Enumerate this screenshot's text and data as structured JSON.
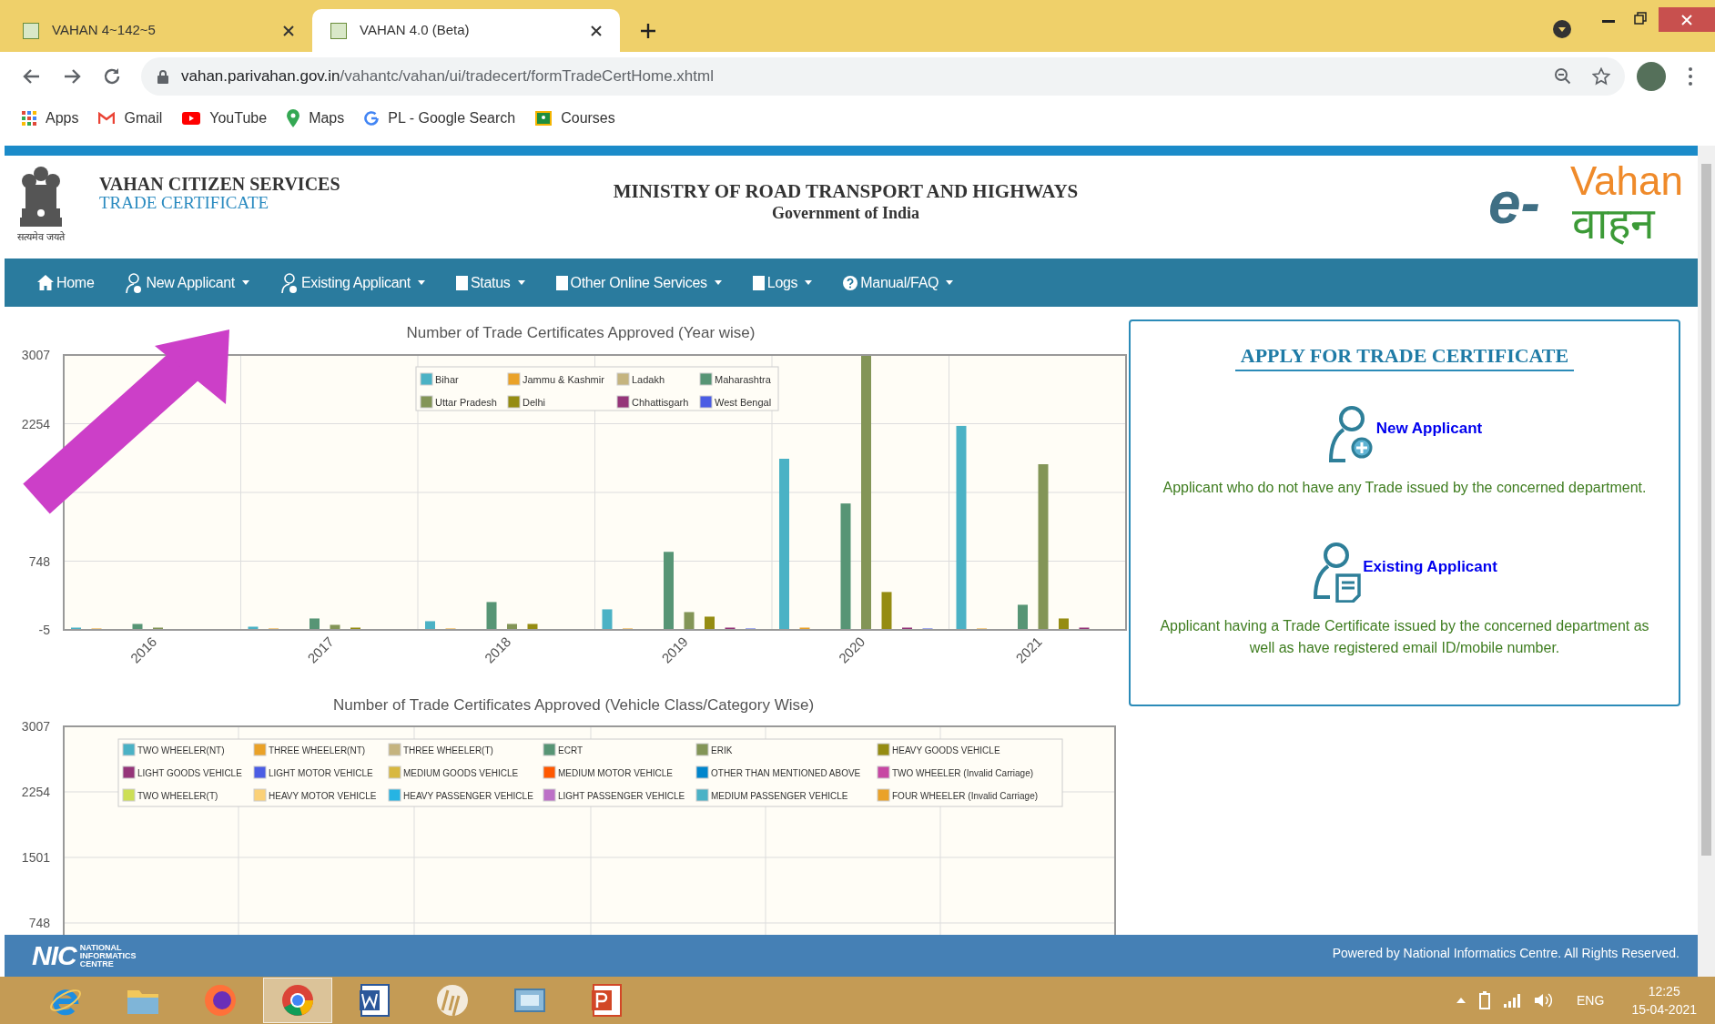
{
  "browser": {
    "tabs": [
      {
        "title": "VAHAN 4~142~5",
        "selected": false
      },
      {
        "title": "VAHAN 4.0 (Beta)",
        "selected": true
      }
    ],
    "address": {
      "domain": "vahan.parivahan.gov.in",
      "path": "/vahantc/vahan/ui/tradecert/formTradeCertHome.xhtml"
    },
    "bookmarks": [
      {
        "kind": "apps",
        "label": "Apps"
      },
      {
        "kind": "gmail",
        "label": "Gmail"
      },
      {
        "kind": "youtube",
        "label": "YouTube"
      },
      {
        "kind": "maps",
        "label": "Maps"
      },
      {
        "kind": "google",
        "label": "PL - Google Search"
      },
      {
        "kind": "classroom",
        "label": "Courses"
      }
    ]
  },
  "header": {
    "emblem_motto": "सत्यमेव जयते",
    "portal": "VAHAN CITIZEN SERVICES",
    "section": "TRADE CERTIFICATE",
    "ministry": "MINISTRY OF ROAD TRANSPORT AND HIGHWAYS",
    "government": "Government of India",
    "logo": {
      "prefix": "e-",
      "latin": "Vahan",
      "devanagari": "वाहन"
    }
  },
  "nav": [
    {
      "kind": "home",
      "label": "Home",
      "dropdown": false
    },
    {
      "kind": "person",
      "label": "New Applicant",
      "dropdown": true
    },
    {
      "kind": "person",
      "label": "Existing Applicant",
      "dropdown": true
    },
    {
      "kind": "page",
      "label": "Status",
      "dropdown": true
    },
    {
      "kind": "page",
      "label": "Other Online Services",
      "dropdown": true
    },
    {
      "kind": "page",
      "label": "Logs",
      "dropdown": true
    },
    {
      "kind": "help",
      "label": "Manual/FAQ",
      "dropdown": true
    }
  ],
  "charts": [
    {
      "chart_data": {
        "type": "bar",
        "title": "Number of Trade Certificates Approved (Year wise)",
        "categories": [
          "2016",
          "2017",
          "2018",
          "2019",
          "2020",
          "2021"
        ],
        "ylim": [
          -5,
          3007
        ],
        "yticks": [
          -5,
          748,
          2254,
          3007
        ],
        "legend": true,
        "grid": true,
        "series": [
          {
            "name": "Bihar",
            "color": "#4bb2c5",
            "values": [
              20,
              30,
              90,
              220,
              1870,
              2230
            ]
          },
          {
            "name": "Jammu & Kashmir",
            "color": "#eaa228",
            "values": [
              10,
              10,
              10,
              10,
              20,
              10
            ]
          },
          {
            "name": "Ladakh",
            "color": "#c5b47f",
            "values": [
              0,
              0,
              0,
              0,
              0,
              0
            ]
          },
          {
            "name": "Maharashtra",
            "color": "#579575",
            "values": [
              60,
              120,
              300,
              850,
              1380,
              270
            ]
          },
          {
            "name": "Uttar Pradesh",
            "color": "#839557",
            "values": [
              20,
              50,
              60,
              190,
              3000,
              1810
            ]
          },
          {
            "name": "Delhi",
            "color": "#958c12",
            "values": [
              0,
              20,
              60,
              140,
              410,
              120
            ]
          },
          {
            "name": "Chhattisgarh",
            "color": "#953579",
            "values": [
              0,
              0,
              0,
              20,
              20,
              20
            ]
          },
          {
            "name": "West Bengal",
            "color": "#4b5de4",
            "values": [
              0,
              0,
              0,
              10,
              10,
              0
            ]
          }
        ]
      }
    },
    {
      "chart_data": {
        "type": "bar",
        "title": "Number of Trade Certificates Approved (Vehicle Class/Category Wise)",
        "ylim": [
          612,
          3007
        ],
        "yticks": [
          748,
          1501,
          2254,
          3007
        ],
        "legend": true,
        "grid": true,
        "series": [
          {
            "name": "TWO WHEELER(NT)",
            "color": "#4bb2c5"
          },
          {
            "name": "THREE WHEELER(NT)",
            "color": "#eaa228"
          },
          {
            "name": "THREE WHEELER(T)",
            "color": "#c5b47f"
          },
          {
            "name": "ECRT",
            "color": "#579575"
          },
          {
            "name": "ERIK",
            "color": "#839557"
          },
          {
            "name": "HEAVY GOODS VEHICLE",
            "color": "#958c12"
          },
          {
            "name": "LIGHT GOODS VEHICLE",
            "color": "#953579"
          },
          {
            "name": "LIGHT MOTOR VEHICLE",
            "color": "#4b5de4"
          },
          {
            "name": "MEDIUM GOODS VEHICLE",
            "color": "#d8b83f"
          },
          {
            "name": "MEDIUM MOTOR VEHICLE",
            "color": "#ff5800"
          },
          {
            "name": "OTHER THAN MENTIONED ABOVE",
            "color": "#0085cc"
          },
          {
            "name": "TWO WHEELER (Invalid Carriage)",
            "color": "#c747a3"
          },
          {
            "name": "TWO WHEELER(T)",
            "color": "#cddf54"
          },
          {
            "name": "HEAVY MOTOR VEHICLE",
            "color": "#fbd178"
          },
          {
            "name": "HEAVY PASSENGER VEHICLE",
            "color": "#26b4e3"
          },
          {
            "name": "LIGHT PASSENGER VEHICLE",
            "color": "#bd70c7"
          },
          {
            "name": "MEDIUM PASSENGER VEHICLE",
            "color": "#4bb2c6"
          },
          {
            "name": "FOUR WHEELER (Invalid Carriage)",
            "color": "#eaa229"
          }
        ]
      }
    }
  ],
  "apply_panel": {
    "title": "APPLY FOR TRADE CERTIFICATE",
    "options": [
      {
        "kind": "new",
        "label": "New Applicant",
        "description": "Applicant who do not have any Trade issued by the concerned department."
      },
      {
        "kind": "existing",
        "label": "Existing Applicant",
        "description": "Applicant having a Trade Certificate issued by the concerned department as well as have registered email ID/mobile number."
      }
    ]
  },
  "footer": {
    "logo": "NIC",
    "logo_caption": "NATIONAL INFORMATICS CENTRE",
    "credit": "Powered by National Informatics Centre. All Rights Reserved."
  },
  "taskbar": {
    "apps": [
      {
        "kind": "ie",
        "selected": false
      },
      {
        "kind": "folder",
        "selected": false
      },
      {
        "kind": "firefox",
        "selected": false
      },
      {
        "kind": "chrome",
        "selected": true
      },
      {
        "kind": "word",
        "selected": false
      },
      {
        "kind": "hp",
        "selected": false
      },
      {
        "kind": "window",
        "selected": false
      },
      {
        "kind": "powerpoint",
        "selected": false
      }
    ],
    "language": "ENG",
    "time": "12:25",
    "date": "15-04-2021"
  }
}
